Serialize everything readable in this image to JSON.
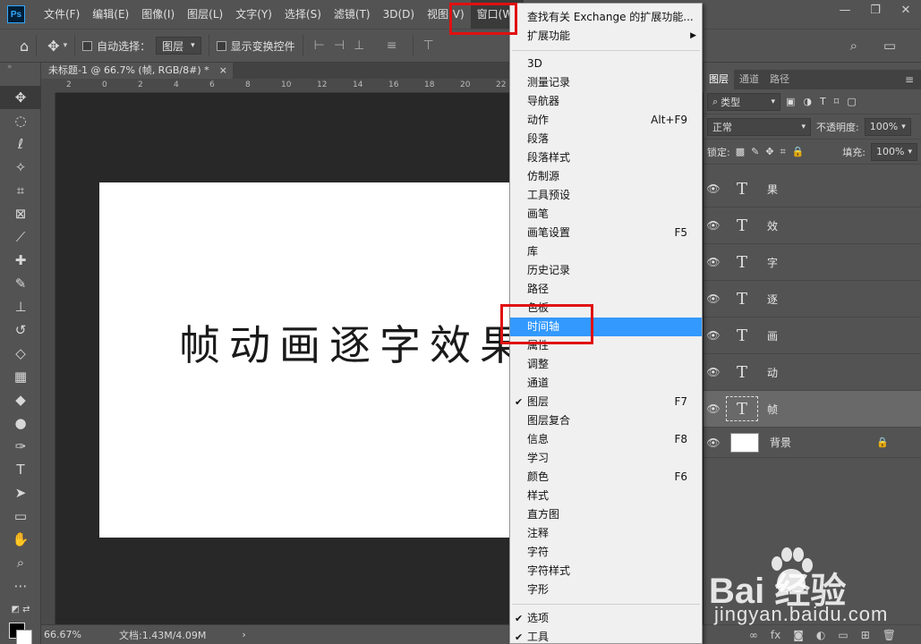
{
  "app": {
    "logo": "Ps"
  },
  "menubar": {
    "items": [
      "文件(F)",
      "编辑(E)",
      "图像(I)",
      "图层(L)",
      "文字(Y)",
      "选择(S)",
      "滤镜(T)",
      "3D(D)",
      "视图(V)",
      "窗口(W)"
    ],
    "active_index": 9
  },
  "window_controls": {
    "minimize": "—",
    "restore": "❐",
    "close": "✕"
  },
  "options": {
    "auto_select_label": "自动选择：",
    "auto_select_value": "图层",
    "show_transform_label": "显示变换控件"
  },
  "document": {
    "tab_title": "未标题-1 @ 66.7% (帧, RGB/8#) *",
    "tab_close": "×",
    "canvas_text": "帧动画逐字效果"
  },
  "ruler": {
    "h_ticks": [
      "2",
      "0",
      "2",
      "4",
      "6",
      "8",
      "10",
      "12",
      "14",
      "16",
      "18",
      "20",
      "22"
    ]
  },
  "status": {
    "zoom": "66.67%",
    "doc_size": "文档:1.43M/4.09M",
    "arrow": "›"
  },
  "panel": {
    "tabs": [
      "图层",
      "通道",
      "路径"
    ],
    "active_tab": 0,
    "filter_label": "类型",
    "blend_mode": "正常",
    "opacity_label": "不透明度:",
    "opacity_value": "100%",
    "lock_label": "锁定:",
    "fill_label": "填充:",
    "fill_value": "100%",
    "layers": [
      {
        "name": "果",
        "type": "text"
      },
      {
        "name": "效",
        "type": "text"
      },
      {
        "name": "字",
        "type": "text"
      },
      {
        "name": "逐",
        "type": "text"
      },
      {
        "name": "画",
        "type": "text"
      },
      {
        "name": "动",
        "type": "text"
      },
      {
        "name": "帧",
        "type": "text",
        "selected": true
      },
      {
        "name": "背景",
        "type": "background",
        "locked": true
      }
    ],
    "text_thumb": "T"
  },
  "dropdown": {
    "items": [
      {
        "label": "查找有关 Exchange 的扩展功能...",
        "shortcut": ""
      },
      {
        "label": "扩展功能",
        "shortcut": "",
        "submenu": "▶"
      },
      {
        "label": "3D",
        "shortcut": ""
      },
      {
        "label": "测量记录",
        "shortcut": ""
      },
      {
        "label": "导航器",
        "shortcut": ""
      },
      {
        "label": "动作",
        "shortcut": "Alt+F9"
      },
      {
        "label": "段落",
        "shortcut": ""
      },
      {
        "label": "段落样式",
        "shortcut": ""
      },
      {
        "label": "仿制源",
        "shortcut": ""
      },
      {
        "label": "工具预设",
        "shortcut": ""
      },
      {
        "label": "画笔",
        "shortcut": ""
      },
      {
        "label": "画笔设置",
        "shortcut": "F5"
      },
      {
        "label": "库",
        "shortcut": ""
      },
      {
        "label": "历史记录",
        "shortcut": ""
      },
      {
        "label": "路径",
        "shortcut": ""
      },
      {
        "label": "色板",
        "shortcut": ""
      },
      {
        "label": "时间轴",
        "shortcut": "",
        "highlighted": true
      },
      {
        "label": "属性",
        "shortcut": ""
      },
      {
        "label": "调整",
        "shortcut": ""
      },
      {
        "label": "通道",
        "shortcut": ""
      },
      {
        "label": "图层",
        "shortcut": "F7",
        "checked": true
      },
      {
        "label": "图层复合",
        "shortcut": ""
      },
      {
        "label": "信息",
        "shortcut": "F8"
      },
      {
        "label": "学习",
        "shortcut": ""
      },
      {
        "label": "颜色",
        "shortcut": "F6"
      },
      {
        "label": "样式",
        "shortcut": ""
      },
      {
        "label": "直方图",
        "shortcut": ""
      },
      {
        "label": "注释",
        "shortcut": ""
      },
      {
        "label": "字符",
        "shortcut": ""
      },
      {
        "label": "字符样式",
        "shortcut": ""
      },
      {
        "label": "字形",
        "shortcut": ""
      },
      {
        "label": "选项",
        "shortcut": "",
        "checked": true
      },
      {
        "label": "工具",
        "shortcut": "",
        "checked": true
      }
    ],
    "check_glyph": "✔"
  },
  "watermark": {
    "brand": "Bai  经验",
    "url": "jingyan.baidu.com"
  },
  "colors": {
    "highlight": "#3399ff",
    "annotation": "#e01010",
    "panel_bg": "#535353",
    "canvas_bg": "#282828"
  }
}
